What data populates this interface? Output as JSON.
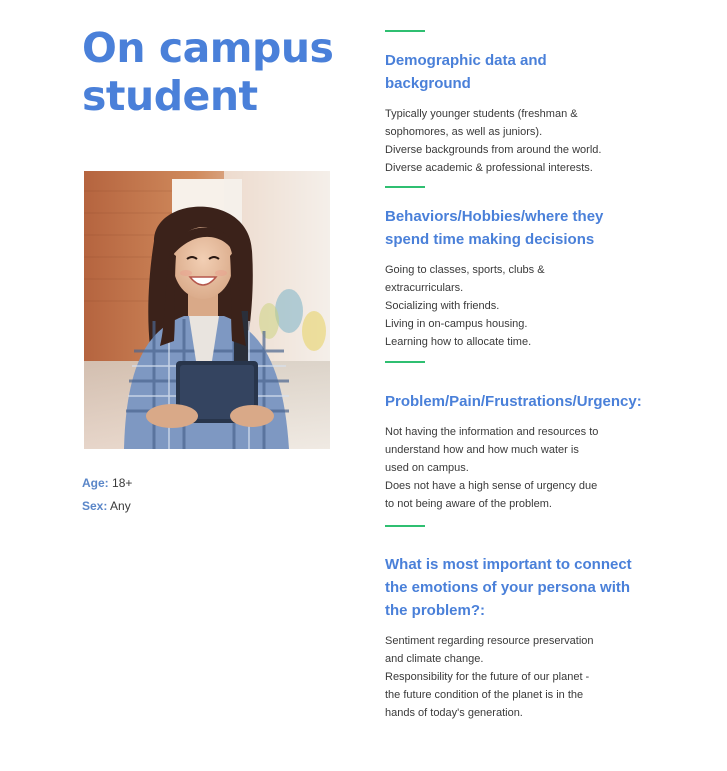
{
  "persona": {
    "title_line1": "On campus",
    "title_line2": "student",
    "age_label": "Age:",
    "age_value": "18+",
    "sex_label": "Sex:",
    "sex_value": "Any"
  },
  "colors": {
    "accent_blue": "#4a80d9",
    "rule_green": "#2fbf71",
    "text": "#3a3a3a"
  },
  "sections": [
    {
      "title_lines": [
        "Demographic data and",
        "background"
      ],
      "lines": [
        "Typically younger students (freshman &",
        "sophomores, as well as juniors).",
        "Diverse backgrounds from around the world.",
        "Diverse academic & professional interests."
      ]
    },
    {
      "title_lines": [
        "Behaviors/Hobbies/where they",
        "spend time making decisions"
      ],
      "lines": [
        "Going to classes, sports, clubs &",
        "extracurriculars.",
        "Socializing with friends.",
        "Living in on-campus housing.",
        "Learning how to allocate time."
      ]
    },
    {
      "title_lines": [
        "Problem/Pain/Frustrations/Urgency:"
      ],
      "lines": [
        "Not having the information and resources to",
        "understand how and how much water is",
        "used on campus.",
        "Does not have a high sense of urgency due",
        "to not being aware of the problem."
      ]
    },
    {
      "title_lines": [
        "What is most important to connect",
        "the emotions of your persona with",
        "the problem?:"
      ],
      "lines": [
        "Sentiment regarding resource preservation",
        "and climate change.",
        "Responsibility for the future of our planet -",
        "the future condition of the planet is in the",
        "hands of today's generation."
      ]
    }
  ]
}
